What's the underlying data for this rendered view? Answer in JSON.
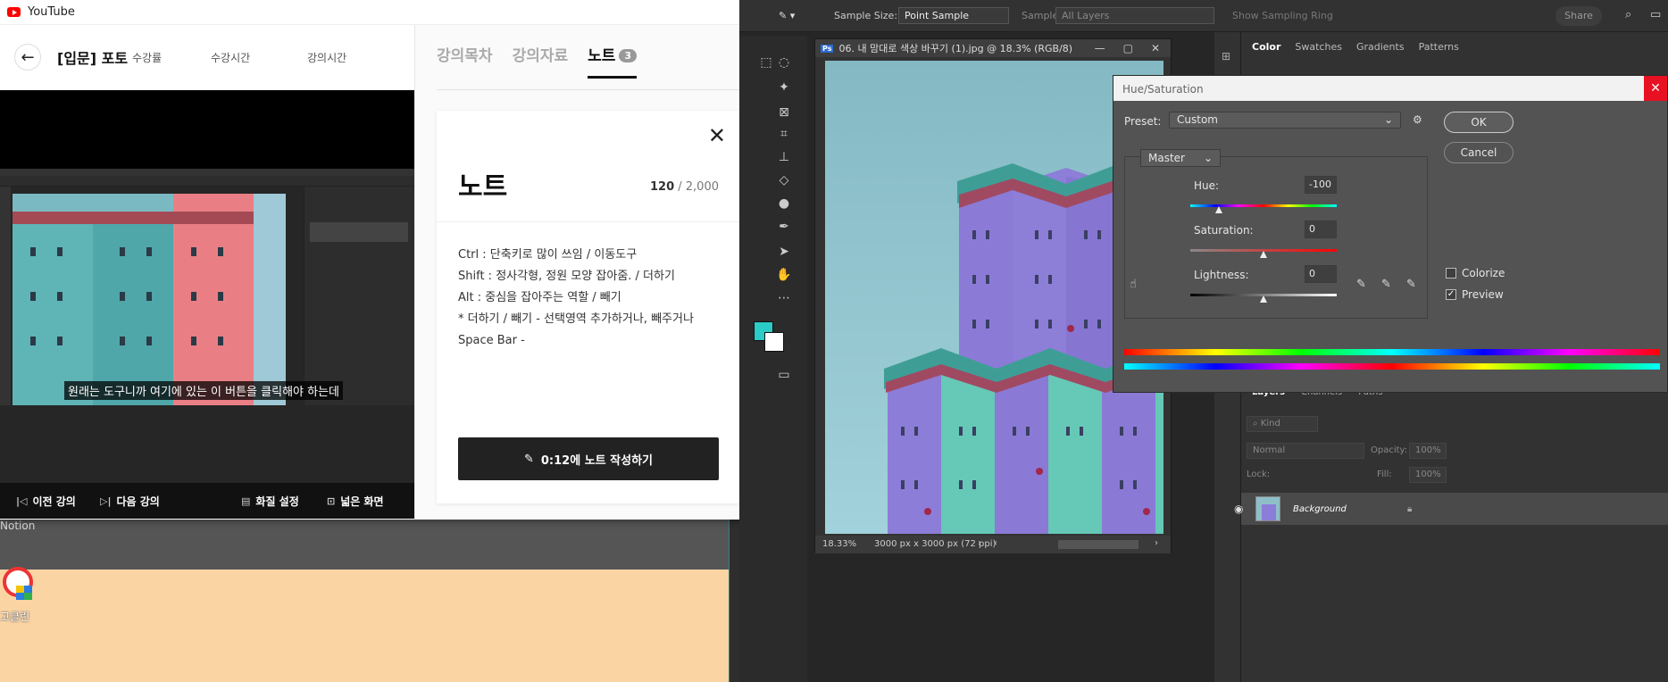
{
  "yt": {
    "app_title": "YouTube",
    "course_title": "[입문] 포토",
    "meta": [
      "수강률",
      "수강시간",
      "강의시간"
    ],
    "subtitle": "원래는 도구니까 여기에 있는 이 버튼을 클릭해야 하는데",
    "controls": {
      "prev": "이전 강의",
      "next": "다음 강의",
      "quality": "화질 설정",
      "wide": "넓은 화면"
    },
    "tabs": [
      {
        "label": "강의목차"
      },
      {
        "label": "강의자료"
      },
      {
        "label": "노트",
        "badge": "3"
      }
    ],
    "note": {
      "heading": "노트",
      "count_current": "120",
      "count_max": "/ 2,000",
      "lines": [
        "Ctrl : 단축키로 많이 쓰임 / 이동도구",
        "Shift : 정사각형, 정원 모양 잡아줌. / 더하기",
        "Alt : 중심을 잡아주는 역할 / 빼기",
        "* 더하기 / 빼기 - 선택영역 추가하거나, 빼주거나",
        "Space Bar -"
      ],
      "button": "0:12에 노트 작성하기"
    }
  },
  "desktop": {
    "notion_label": "Notion",
    "icon_label": "고클린"
  },
  "ps": {
    "options": {
      "sample_size_label": "Sample Size:",
      "sample_size_value": "Point Sample",
      "sample_label": "Sample:",
      "sample_value": "All Layers",
      "show_ring": "Show Sampling Ring",
      "share": "Share"
    },
    "doc": {
      "title": "06. 내 맘대로 색상 바꾸기 (1).jpg @ 18.3% (RGB/8)",
      "zoom": "18.33%",
      "dims": "3000 px x 3000 px (72 ppi)"
    },
    "hue_sat": {
      "title": "Hue/Saturation",
      "preset_label": "Preset:",
      "preset_value": "Custom",
      "ok": "OK",
      "cancel": "Cancel",
      "channel": "Master",
      "hue_label": "Hue:",
      "hue_value": "-100",
      "sat_label": "Saturation:",
      "sat_value": "0",
      "light_label": "Lightness:",
      "light_value": "0",
      "colorize": "Colorize",
      "preview": "Preview"
    },
    "panels": {
      "color_tabs": [
        "Color",
        "Swatches",
        "Gradients",
        "Patterns"
      ],
      "layer_tabs": [
        "Layers",
        "Channels",
        "Paths"
      ],
      "kind": "Kind",
      "blend": "Normal",
      "opacity_label": "Opacity:",
      "opacity_value": "100%",
      "lock_label": "Lock:",
      "fill_label": "Fill:",
      "fill_value": "100%",
      "layer_name": "Background"
    }
  }
}
